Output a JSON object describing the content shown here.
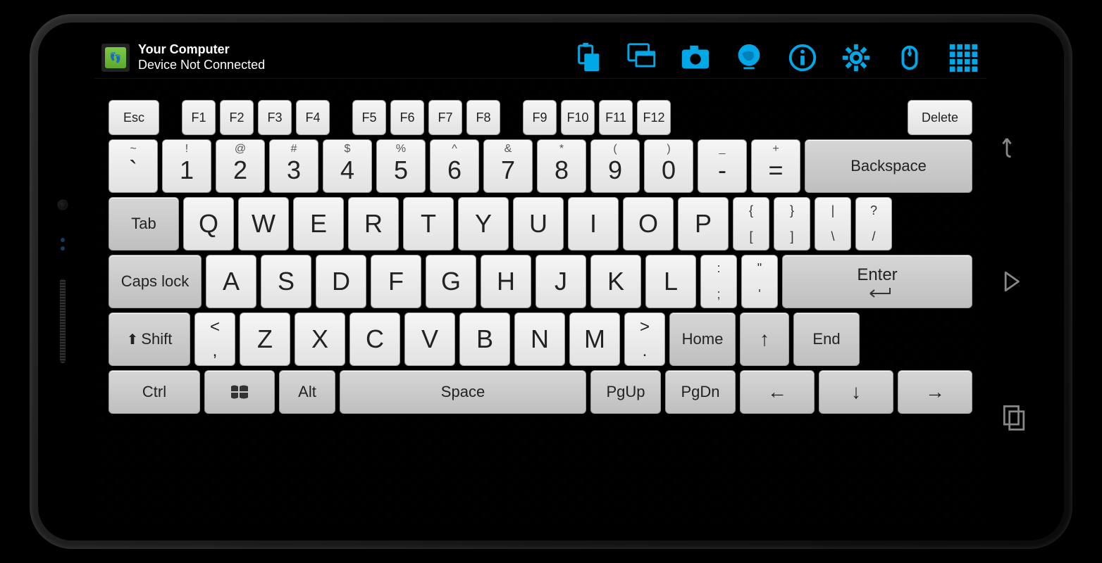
{
  "header": {
    "title": "Your Computer",
    "subtitle": "Device Not Connected"
  },
  "actions": {
    "clipboard": "clipboard",
    "windows": "windows",
    "camera": "camera",
    "globe": "globe",
    "info": "info",
    "settings": "settings",
    "mouse": "mouse",
    "grid": "grid"
  },
  "keys": {
    "esc": "Esc",
    "f1": "F1",
    "f2": "F2",
    "f3": "F3",
    "f4": "F4",
    "f5": "F5",
    "f6": "F6",
    "f7": "F7",
    "f8": "F8",
    "f9": "F9",
    "f10": "F10",
    "f11": "F11",
    "f12": "F12",
    "delete": "Delete",
    "backtick_top": "~",
    "backtick_bot": "`",
    "n1_top": "!",
    "n1_bot": "1",
    "n2_top": "@",
    "n2_bot": "2",
    "n3_top": "#",
    "n3_bot": "3",
    "n4_top": "$",
    "n4_bot": "4",
    "n5_top": "%",
    "n5_bot": "5",
    "n6_top": "^",
    "n6_bot": "6",
    "n7_top": "&",
    "n7_bot": "7",
    "n8_top": "*",
    "n8_bot": "8",
    "n9_top": "(",
    "n9_bot": "9",
    "n0_top": ")",
    "n0_bot": "0",
    "minus_top": "_",
    "minus_bot": "-",
    "eq_top": "+",
    "eq_bot": "=",
    "backspace": "Backspace",
    "tab": "Tab",
    "q": "Q",
    "w": "W",
    "e": "E",
    "r": "R",
    "t": "T",
    "y": "Y",
    "u": "U",
    "i": "I",
    "o": "O",
    "p": "P",
    "lbr_top": "{",
    "lbr_bot": "[",
    "rbr_top": "}",
    "rbr_bot": "]",
    "bslash_top": "|",
    "bslash_bot": "\\",
    "qm_top": "?",
    "qm_bot": "/",
    "caps": "Caps lock",
    "a": "A",
    "s": "S",
    "d": "D",
    "f": "F",
    "g": "G",
    "h": "H",
    "j": "J",
    "k": "K",
    "l": "L",
    "semi_top": ":",
    "semi_bot": ";",
    "quote_top": "\"",
    "quote_bot": "'",
    "enter": "Enter",
    "shift": "Shift",
    "lt_top": "<",
    "lt_bot": ",",
    "gt_top": ">",
    "gt_bot": ".",
    "z": "Z",
    "x": "X",
    "c": "C",
    "v": "V",
    "b": "B",
    "n": "N",
    "m": "M",
    "home": "Home",
    "up": "↑",
    "end": "End",
    "ctrl": "Ctrl",
    "alt": "Alt",
    "space": "Space",
    "pgup": "PgUp",
    "pgdn": "PgDn",
    "left": "←",
    "down": "↓",
    "right": "→",
    "enter_arrow": "↵",
    "shift_arrow": "↑"
  }
}
